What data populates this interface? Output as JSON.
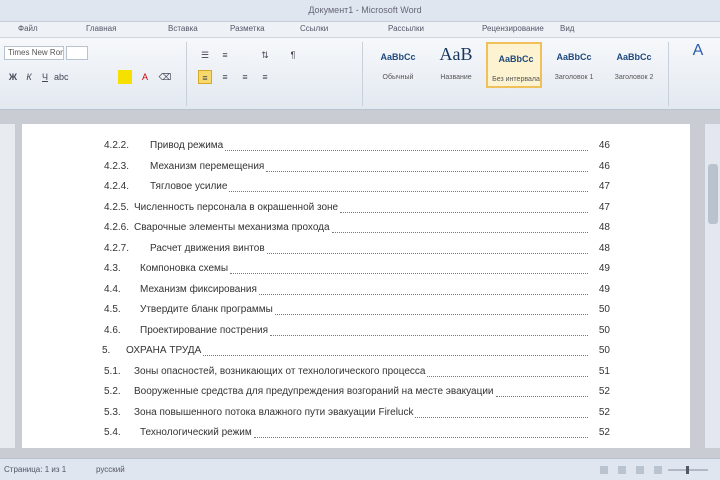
{
  "toc": [
    {
      "num": "4.2.2.",
      "title": "Привод режима",
      "page": "46"
    },
    {
      "num": "4.2.3.",
      "title": "Механизм перемещения",
      "page": "46"
    },
    {
      "num": "4.2.4.",
      "title": "Тягловое усилие",
      "page": "47"
    },
    {
      "num": "4.2.5.",
      "title": "Численность персонала в окрашенной зоне",
      "page": "47"
    },
    {
      "num": "4.2.6.",
      "title": "Сварочные элементы механизма прохода",
      "page": "48"
    },
    {
      "num": "4.2.7.",
      "title": "Расчет движения винтов",
      "page": "48"
    },
    {
      "num": "4.3.",
      "title": "Компоновка схемы",
      "page": "49"
    },
    {
      "num": "4.4.",
      "title": "Механизм фиксирования",
      "page": "49"
    },
    {
      "num": "4.5.",
      "title": "Утвердите бланк программы",
      "page": "50"
    },
    {
      "num": "4.6.",
      "title": "Проектирование пострения",
      "page": "50"
    },
    {
      "num": "5.",
      "title": "ОХРАНА ТРУДА",
      "page": "50"
    },
    {
      "num": "5.1.",
      "title": "Зоны опасностей, возникающих от технологического процесса",
      "page": "51"
    },
    {
      "num": "5.2.",
      "title": "Вооруженные средства для предупреждения возгораний на месте эвакуации",
      "page": "52"
    },
    {
      "num": "5.3.",
      "title": "Зона повышенного потока влажного пути эвакуации Fireluck",
      "page": "52"
    },
    {
      "num": "5.4.",
      "title": "Технологический режим",
      "page": "52"
    }
  ]
}
